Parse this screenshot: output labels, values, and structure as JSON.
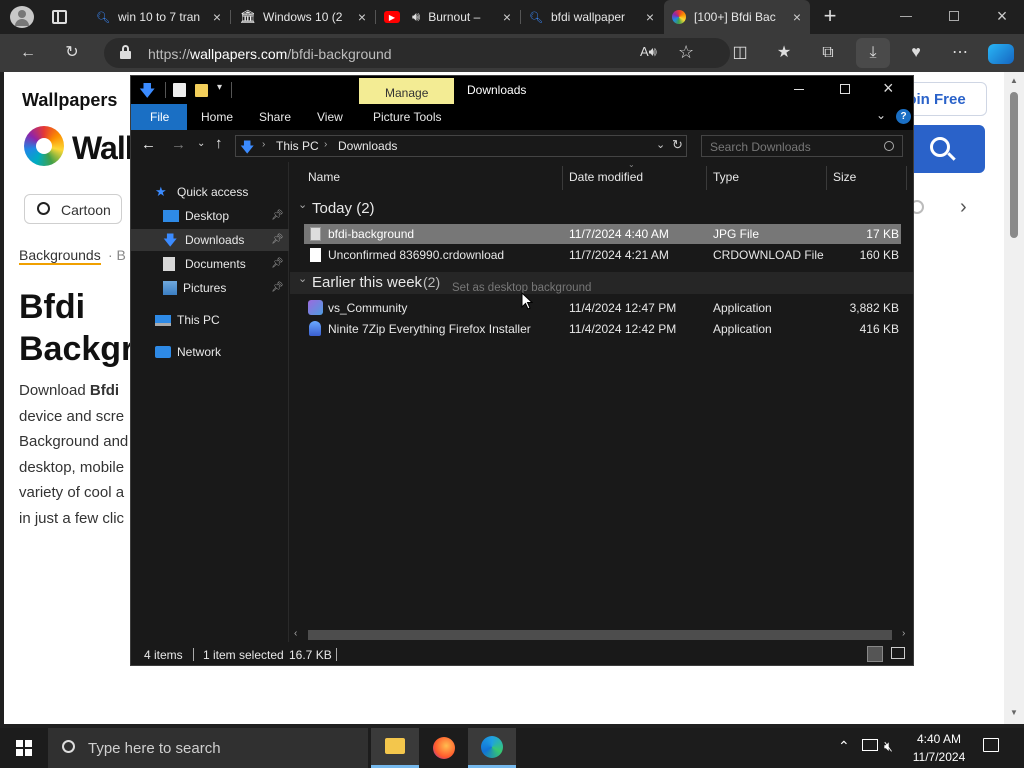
{
  "browser": {
    "tabs": [
      {
        "title": "win 10 to 7 tran",
        "icon": "search-icon"
      },
      {
        "title": "Windows 10 (2",
        "icon": "archive-icon"
      },
      {
        "title": "Burnout –",
        "icon": "youtube-icon"
      },
      {
        "title": "bfdi wallpaper",
        "icon": "search-icon"
      },
      {
        "title": "[100+] Bfdi Bac",
        "icon": "wallpapers-logo-icon",
        "active": true
      }
    ],
    "url_prefix": "https://",
    "url_host": "wallpapers.com",
    "url_path": "/bfdi-background"
  },
  "webpage": {
    "site_name": "Wallpapers",
    "logo_text": "Wallp",
    "join_label": "Join Free",
    "chip_label": "Cartoon",
    "breadcrumb": "Backgrounds",
    "breadcrumb_sep": "· B",
    "heading_line1": "Bfdi",
    "heading_line2": "Backgr",
    "para_lines": [
      "Download Bfdi",
      "device and scre",
      "Background and",
      "desktop, mobile",
      "variety of cool a",
      "in just a few clic"
    ]
  },
  "explorer": {
    "ribbon_context": "Manage",
    "window_title": "Downloads",
    "ribbon_tabs": [
      "File",
      "Home",
      "Share",
      "View",
      "Picture Tools"
    ],
    "path": [
      "This PC",
      "Downloads"
    ],
    "search_placeholder": "Search Downloads",
    "nav": {
      "quick_access": "Quick access",
      "items": [
        "Desktop",
        "Downloads",
        "Documents",
        "Pictures"
      ],
      "this_pc": "This PC",
      "network": "Network"
    },
    "columns": [
      "Name",
      "Date modified",
      "Type",
      "Size"
    ],
    "groups": [
      {
        "label": "Today (2)",
        "rows": [
          {
            "name": "bfdi-background",
            "date": "11/7/2024 4:40 AM",
            "type": "JPG File",
            "size": "17 KB",
            "selected": true
          },
          {
            "name": "Unconfirmed 836990.crdownload",
            "date": "11/7/2024 4:21 AM",
            "type": "CRDOWNLOAD File",
            "size": "160 KB"
          }
        ]
      },
      {
        "label": "Earlier this week",
        "count": "(2)",
        "rows": [
          {
            "name": "vs_Community",
            "date": "11/4/2024 12:47 PM",
            "type": "Application",
            "size": "3,882 KB"
          },
          {
            "name": "Ninite 7Zip Everything Firefox Installer",
            "date": "11/4/2024 12:42 PM",
            "type": "Application",
            "size": "416 KB"
          }
        ]
      }
    ],
    "tooltip": "Set as desktop background",
    "status": {
      "items": "4 items",
      "selected": "1 item selected",
      "size": "16.7 KB"
    }
  },
  "taskbar": {
    "search_placeholder": "Type here to search",
    "time": "4:40 AM",
    "date": "11/7/2024"
  },
  "colors": {
    "accent": "#2a62c9",
    "selection": "#777777",
    "ribbon_file": "#1a6fc4",
    "manage_tab": "#f3ec94"
  }
}
